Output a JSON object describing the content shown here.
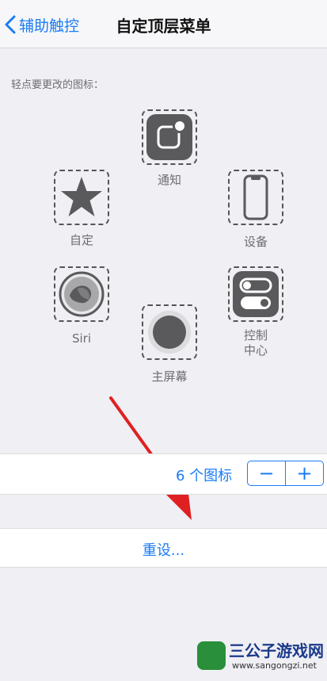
{
  "nav": {
    "back_label": "辅助触控",
    "title": "自定顶层菜单"
  },
  "hint": "轻点要更改的图标：",
  "icons": [
    {
      "label": "通知"
    },
    {
      "label": "自定"
    },
    {
      "label": "设备"
    },
    {
      "label": "Siri"
    },
    {
      "label": "控制\n中心"
    },
    {
      "label": "主屏幕"
    }
  ],
  "count": {
    "label": "6 个图标",
    "minus": "−",
    "plus": "+"
  },
  "reset_label": "重设...",
  "watermark": {
    "name": "三公子游戏网",
    "url": "www.sangongzi.net"
  },
  "colors": {
    "accent": "#1a7cf5",
    "annotation_arrow": "#e02020"
  }
}
